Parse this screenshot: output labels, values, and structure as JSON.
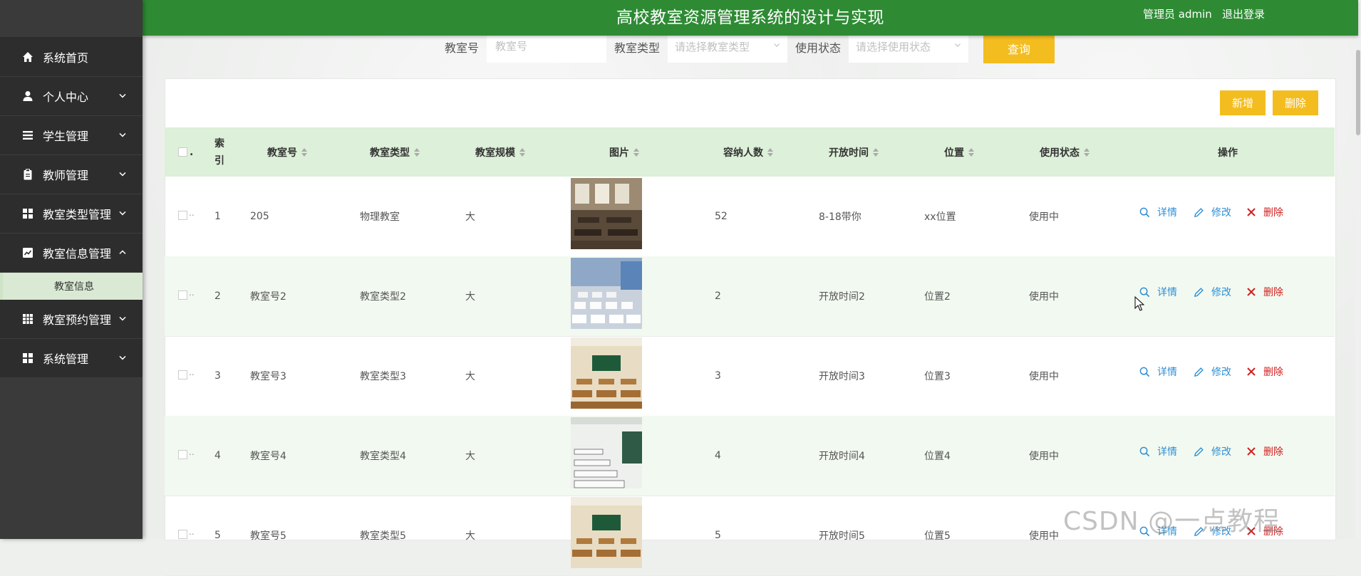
{
  "header": {
    "title": "高校教室资源管理系统的设计与实现",
    "user": "管理员 admin",
    "logout": "退出登录"
  },
  "sidebar": {
    "items": [
      {
        "label": "系统首页",
        "icon": "home-icon"
      },
      {
        "label": "个人中心",
        "icon": "user-icon"
      },
      {
        "label": "学生管理",
        "icon": "list-icon"
      },
      {
        "label": "教师管理",
        "icon": "clipboard-icon"
      },
      {
        "label": "教室类型管理",
        "icon": "grid-icon"
      },
      {
        "label": "教室信息管理",
        "icon": "chart-icon"
      },
      {
        "label": "教室预约管理",
        "icon": "table-icon"
      },
      {
        "label": "系统管理",
        "icon": "grid-icon"
      }
    ],
    "submenu_label": "教室信息"
  },
  "search": {
    "room_no_label": "教室号",
    "room_no_placeholder": "教室号",
    "room_type_label": "教室类型",
    "room_type_placeholder": "请选择教室类型",
    "status_label": "使用状态",
    "status_placeholder": "请选择使用状态",
    "query_button": "查询"
  },
  "toolbar": {
    "add_button": "新增",
    "delete_button": "删除"
  },
  "table": {
    "headers": {
      "index": "索引",
      "room_no": "教室号",
      "room_type": "教室类型",
      "scale": "教室规模",
      "image": "图片",
      "capacity": "容纳人数",
      "open_time": "开放时间",
      "location": "位置",
      "status": "使用状态",
      "actions": "操作"
    },
    "action_labels": {
      "detail": "详情",
      "edit": "修改",
      "delete": "删除"
    },
    "rows": [
      {
        "index": "1",
        "room_no": "205",
        "room_type": "物理教室",
        "scale": "大",
        "capacity": "52",
        "open_time": "8-18带你",
        "location": "xx位置",
        "status": "使用中"
      },
      {
        "index": "2",
        "room_no": "教室号2",
        "room_type": "教室类型2",
        "scale": "大",
        "capacity": "2",
        "open_time": "开放时间2",
        "location": "位置2",
        "status": "使用中"
      },
      {
        "index": "3",
        "room_no": "教室号3",
        "room_type": "教室类型3",
        "scale": "大",
        "capacity": "3",
        "open_time": "开放时间3",
        "location": "位置3",
        "status": "使用中"
      },
      {
        "index": "4",
        "room_no": "教室号4",
        "room_type": "教室类型4",
        "scale": "大",
        "capacity": "4",
        "open_time": "开放时间4",
        "location": "位置4",
        "status": "使用中"
      },
      {
        "index": "5",
        "room_no": "教室号5",
        "room_type": "教室类型5",
        "scale": "大",
        "capacity": "5",
        "open_time": "开放时间5",
        "location": "位置5",
        "status": "使用中"
      }
    ]
  },
  "watermark": "CSDN @一点教程",
  "colors": {
    "header": "#2e8b34",
    "sidebar": "#2d2d2d",
    "accent_yellow": "#f3bd20",
    "table_head": "#ddf0d9",
    "link_blue": "#2f8fd5",
    "delete_red": "#d02020"
  }
}
